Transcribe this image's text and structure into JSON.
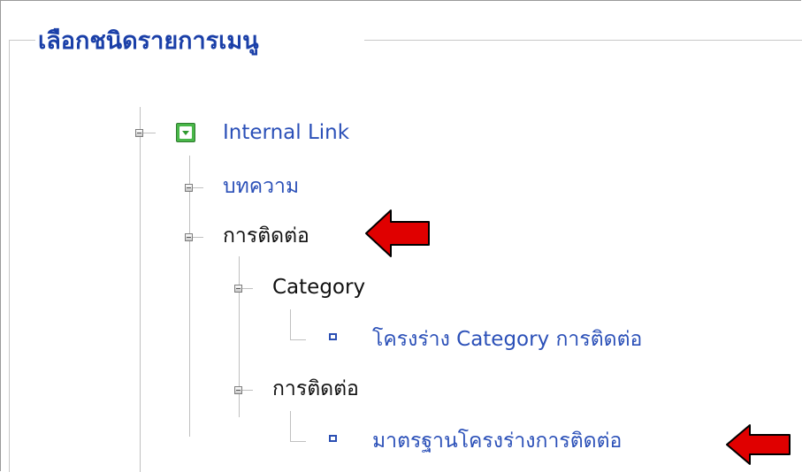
{
  "panel": {
    "legend": "เลือกชนิดรายการเมนู"
  },
  "tree": {
    "root": {
      "label": "Internal Link",
      "color": "#2b50b8"
    },
    "items": [
      {
        "label": "บทความ"
      },
      {
        "label": "การติดต่อ"
      },
      {
        "label": "Category"
      },
      {
        "label": "โครงร่าง Category การติดต่อ"
      },
      {
        "label": "การติดต่อ"
      },
      {
        "label": "มาตรฐานโครงร่างการติดต่อ"
      }
    ]
  },
  "annotations": {
    "arrow_color": "#e00000"
  }
}
